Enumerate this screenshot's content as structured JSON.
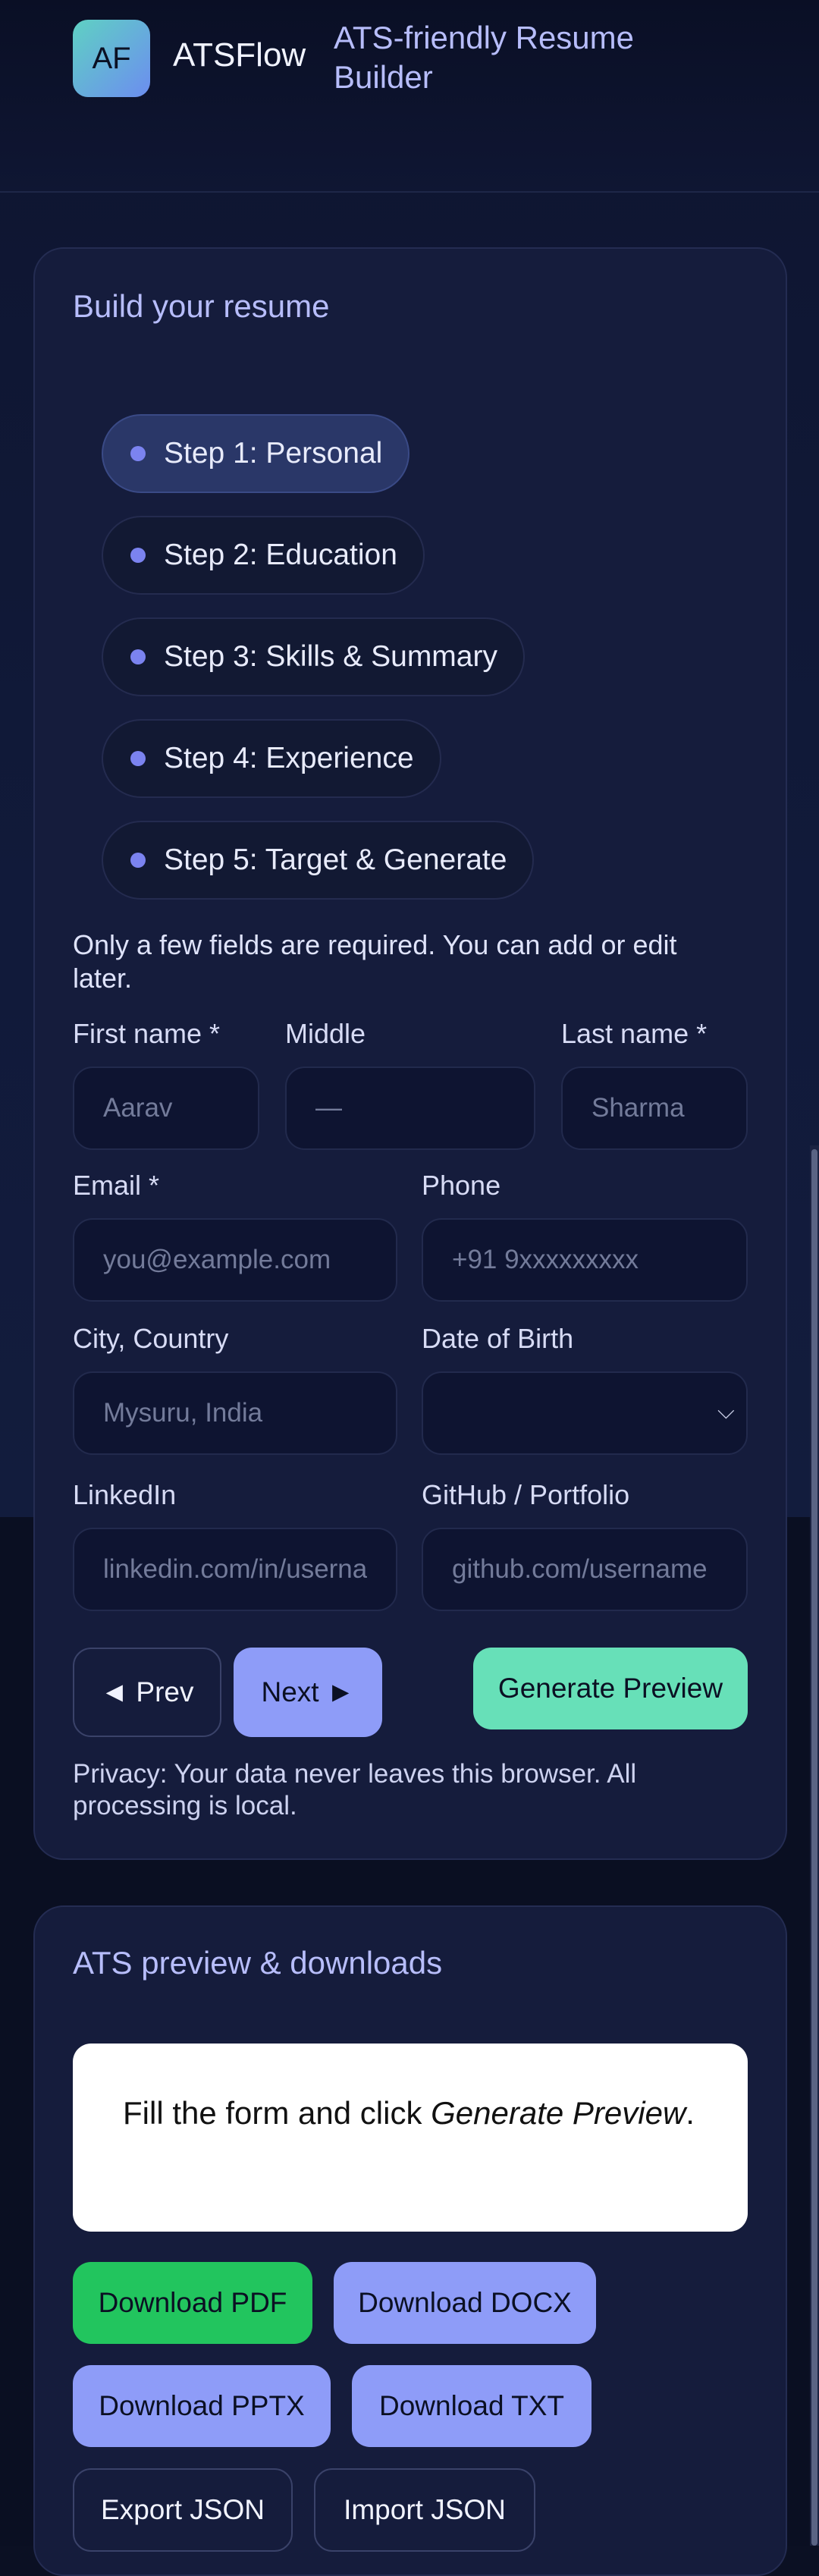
{
  "header": {
    "logo_text": "AF",
    "brand": "ATSFlow",
    "tagline": "ATS-friendly Resume Builder"
  },
  "builder": {
    "title": "Build your resume",
    "steps": [
      {
        "label": "Step 1: Personal",
        "active": true
      },
      {
        "label": "Step 2: Education",
        "active": false
      },
      {
        "label": "Step 3: Skills & Summary",
        "active": false
      },
      {
        "label": "Step 4: Experience",
        "active": false
      },
      {
        "label": "Step 5: Target & Generate",
        "active": false
      }
    ],
    "note": "Only a few fields are required. You can add or edit later.",
    "fields": {
      "first_name": {
        "label": "First name *",
        "placeholder": "Aarav",
        "value": ""
      },
      "middle": {
        "label": "Middle",
        "placeholder": "—",
        "value": ""
      },
      "last_name": {
        "label": "Last name *",
        "placeholder": "Sharma",
        "value": ""
      },
      "email": {
        "label": "Email *",
        "placeholder": "you@example.com",
        "value": ""
      },
      "phone": {
        "label": "Phone",
        "placeholder": "+91 9xxxxxxxxx",
        "value": ""
      },
      "city": {
        "label": "City, Country",
        "placeholder": "Mysuru, India",
        "value": ""
      },
      "dob": {
        "label": "Date of Birth",
        "value": ""
      },
      "linkedin": {
        "label": "LinkedIn",
        "placeholder": "linkedin.com/in/username",
        "value": ""
      },
      "github": {
        "label": "GitHub / Portfolio",
        "placeholder": "github.com/username",
        "value": ""
      }
    },
    "buttons": {
      "prev": "◄ Prev",
      "next": "Next ►",
      "generate": "Generate Preview"
    },
    "privacy": "Privacy: Your data never leaves this browser. All processing is local."
  },
  "preview": {
    "title": "ATS preview & downloads",
    "message_prefix": "Fill the form and click ",
    "message_emphasis": "Generate Preview",
    "message_suffix": ".",
    "buttons": {
      "pdf": "Download PDF",
      "docx": "Download DOCX",
      "pptx": "Download PPTX",
      "txt": "Download TXT",
      "export_json": "Export JSON",
      "import_json": "Import JSON"
    }
  },
  "colors": {
    "accent": "#8e9cf8",
    "green": "#67e0b8",
    "pdf_green": "#22c55e",
    "background": "#0b1023"
  },
  "icons": {
    "step_bullet": "dot-icon",
    "select": "chevron-down-icon"
  }
}
